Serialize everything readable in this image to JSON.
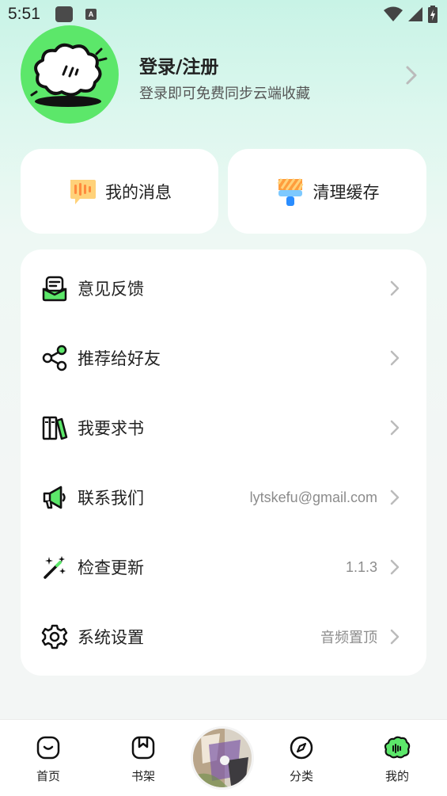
{
  "status_bar": {
    "time": "5:51",
    "notification_icon_letter": "A",
    "icons": [
      "wifi-icon",
      "signal-icon",
      "battery-icon"
    ]
  },
  "profile": {
    "title": "登录/注册",
    "subtitle": "登录即可免费同步云端收藏"
  },
  "quick_cards": {
    "messages_label": "我的消息",
    "clear_cache_label": "清理缓存"
  },
  "menu": {
    "items": [
      {
        "label": "意见反馈",
        "value": "",
        "icon": "feedback-icon"
      },
      {
        "label": "推荐给好友",
        "value": "",
        "icon": "share-icon"
      },
      {
        "label": "我要求书",
        "value": "",
        "icon": "books-icon"
      },
      {
        "label": "联系我们",
        "value": "lytskefu@gmail.com",
        "icon": "megaphone-icon"
      },
      {
        "label": "检查更新",
        "value": "1.1.3",
        "icon": "magic-wand-icon"
      },
      {
        "label": "系统设置",
        "value": "音频置顶",
        "icon": "gear-icon"
      }
    ]
  },
  "tabbar": {
    "items": [
      {
        "label": "首页",
        "icon": "home-icon"
      },
      {
        "label": "书架",
        "icon": "bookshelf-icon"
      },
      {
        "label": "分类",
        "icon": "compass-icon"
      },
      {
        "label": "我的",
        "icon": "profile-cloud-icon"
      }
    ],
    "accent": "#5ce76a"
  },
  "colors": {
    "accent_green": "#5ce76a",
    "text_primary": "#222222",
    "text_secondary": "#8c8c8c"
  }
}
